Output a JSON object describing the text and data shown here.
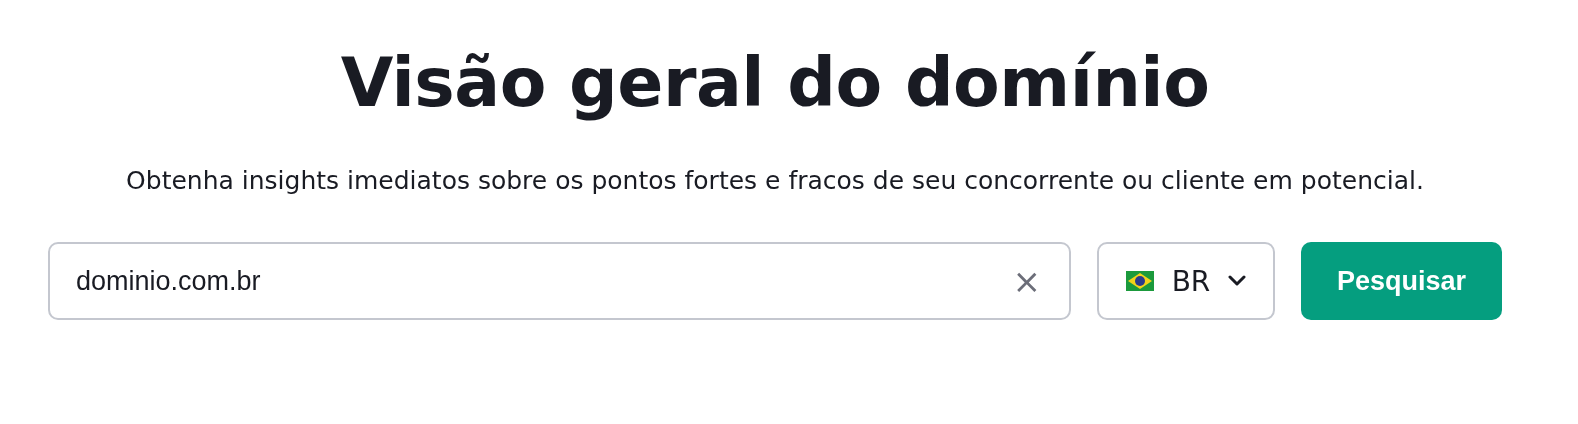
{
  "title": "Visão geral do domínio",
  "subtitle": "Obtenha insights imediatos sobre os pontos fortes e fracos de seu concorrente ou cliente em potencial.",
  "search": {
    "value": "dominio.com.br",
    "clear": "×"
  },
  "country": {
    "code": "BR"
  },
  "button": "Pesquisar"
}
